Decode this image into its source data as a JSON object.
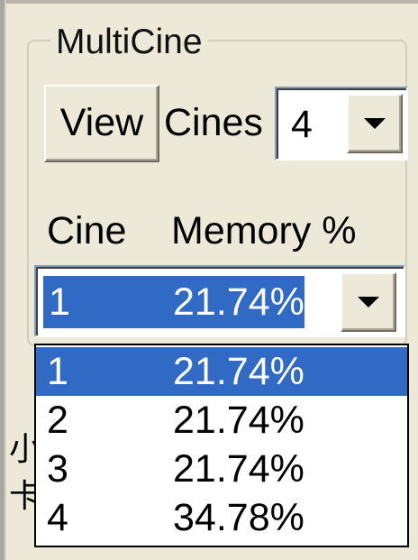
{
  "group": {
    "title": "MultiCine"
  },
  "view_button": {
    "label": "View"
  },
  "cines": {
    "label": "Cines",
    "selected": "4"
  },
  "columns": {
    "cine": "Cine",
    "memory": "Memory %"
  },
  "memory_select": {
    "cine": "1",
    "memory": "21.74%"
  },
  "dropdown": {
    "items": [
      {
        "cine": "1",
        "memory": "21.74%"
      },
      {
        "cine": "2",
        "memory": "21.74%"
      },
      {
        "cine": "3",
        "memory": "21.74%"
      },
      {
        "cine": "4",
        "memory": "34.78%"
      }
    ],
    "highlighted_index": 0
  },
  "icons": {
    "dropdown_arrow": "chevron-down-icon"
  },
  "colors": {
    "background": "#ECE9D8",
    "selection": "#316AC5",
    "selection_text": "#FFFFFF",
    "field_border": "#7F9DB9"
  }
}
